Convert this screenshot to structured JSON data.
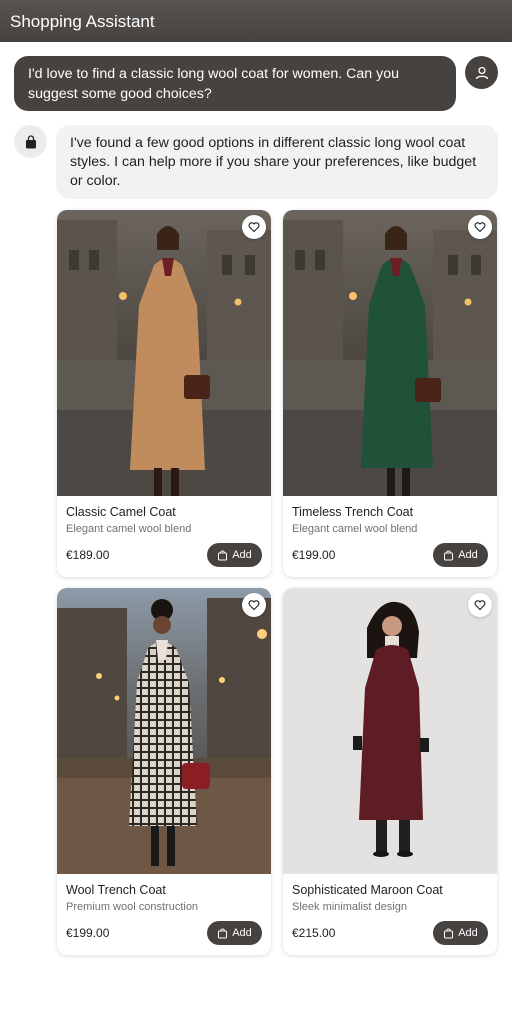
{
  "header": {
    "title": "Shopping Assistant"
  },
  "conversation": {
    "user_message": "I'd love to find a classic long wool coat for women. Can you suggest some good choices?",
    "assistant_message": "I've found a few good options in different classic long wool coat styles. I can help more if you share your preferences, like budget or color."
  },
  "products": [
    {
      "name": "Classic Camel Coat",
      "description": "Elegant camel wool blend",
      "price": "€189.00",
      "add_label": "Add",
      "coat_color": "#c08c5e"
    },
    {
      "name": "Timeless Trench Coat",
      "description": "Elegant camel wool blend",
      "price": "€199.00",
      "add_label": "Add",
      "coat_color": "#1f5238"
    },
    {
      "name": "Wool Trench Coat",
      "description": "Premium wool construction",
      "price": "€199.00",
      "add_label": "Add",
      "coat_color": "#cfc6bb"
    },
    {
      "name": "Sophisticated Maroon Coat",
      "description": "Sleek minimalist design",
      "price": "€215.00",
      "add_label": "Add",
      "coat_color": "#5e1d25"
    }
  ],
  "icons": {
    "user_avatar": "person-icon",
    "assistant_avatar": "shopping-bag-icon",
    "favorite": "heart-icon",
    "add": "bag-icon"
  },
  "colors": {
    "header_bg": "#46423f",
    "user_bubble": "#46423f",
    "assistant_bubble": "#f1f2f4",
    "button_bg": "#46423f"
  }
}
